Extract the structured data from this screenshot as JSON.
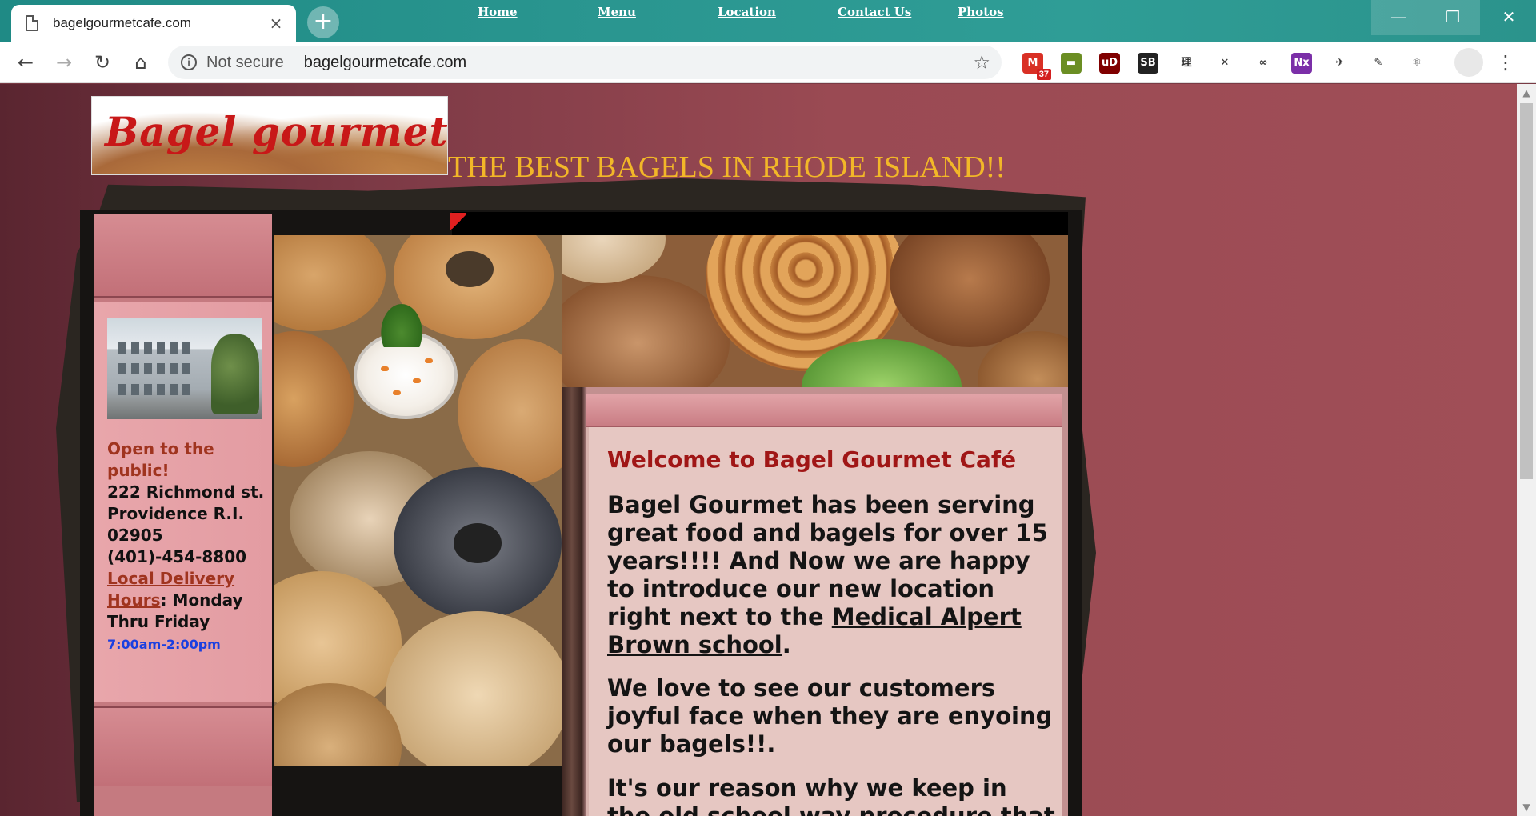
{
  "browser": {
    "tab_title": "bagelgourmetcafe.com",
    "tab_close": "×",
    "new_tab": "+",
    "security_label": "Not secure",
    "url": "bagelgourmetcafe.com",
    "window_controls": {
      "minimize": "—",
      "maximize": "❐",
      "close": "✕"
    },
    "nav_icons": {
      "back": "←",
      "forward": "→",
      "reload": "↻",
      "home": "⌂",
      "star": "☆",
      "menu": "⋮"
    },
    "extensions": [
      {
        "name": "gmail-extension-icon",
        "label": "M",
        "badge": "37",
        "color": "#d93025"
      },
      {
        "name": "notes-extension-icon",
        "label": "▬",
        "color": "#6b8e23"
      },
      {
        "name": "ublock-extension-icon",
        "label": "uD",
        "color": "#800000"
      },
      {
        "name": "sb-extension-icon",
        "label": "SB",
        "color": "#222222"
      },
      {
        "name": "kanji-extension-icon",
        "label": "理",
        "color": "#ffffff"
      },
      {
        "name": "x-extension-icon",
        "label": "✕",
        "color": "#ffffff"
      },
      {
        "name": "link-extension-icon",
        "label": "∞",
        "color": "#ffffff"
      },
      {
        "name": "onenote-extension-icon",
        "label": "Nx",
        "color": "#7b2fa8"
      },
      {
        "name": "plane-extension-icon",
        "label": "✈",
        "color": "#ffffff"
      },
      {
        "name": "pen-extension-icon",
        "label": "✎",
        "color": "#ffffff"
      },
      {
        "name": "react-extension-icon",
        "label": "⚛",
        "color": "#ffffff"
      }
    ]
  },
  "site": {
    "logo_text": "Bagel gourmet cafe",
    "tagline": "THE BEST BAGELS IN RHODE ISLAND!!",
    "nav": {
      "home": "Home",
      "menu": "Menu",
      "location": "Location",
      "contact": "Contact Us",
      "photos": "Photos"
    },
    "sidebar": {
      "open": "Open to the public!",
      "address_line1": "222 Richmond st. Providence R.I. 02905",
      "phone": "(401)-454-8800",
      "delivery_link": "Local Delivery Hours",
      "delivery_suffix": ": Monday Thru Friday",
      "hours": "7:00am-2:00pm"
    },
    "content": {
      "welcome": "Welcome to Bagel Gourmet Café",
      "para1_start": "Bagel Gourmet has been serving great food and bagels for over 15 years!!!! And Now we are happy to introduce our new location right next to the ",
      "para1_link": "Medical Alpert Brown school",
      "para1_end": ".",
      "para2": "We love to see our customers joyful face when they are enyoing our bagels!!.",
      "para3_start": "It's our reason why we keep in the old school way procedure that"
    }
  }
}
